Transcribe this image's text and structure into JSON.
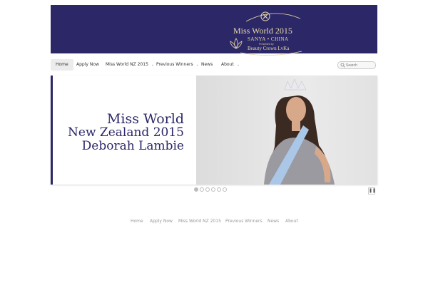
{
  "header": {
    "logo": {
      "title": "Miss World 2015",
      "subtitle": "SANYA • CHINA",
      "powered_by": "Presented by",
      "brand": "Beauty Crown LvKa"
    }
  },
  "nav": {
    "items": [
      {
        "label": "Home",
        "active": true
      },
      {
        "label": "Apply Now"
      },
      {
        "label": "Miss World NZ 2015",
        "has_dropdown": true
      },
      {
        "label": "Previous Winners",
        "has_dropdown": true
      },
      {
        "label": "News"
      },
      {
        "label": "About",
        "has_dropdown": true
      }
    ],
    "search_placeholder": "Search"
  },
  "slider": {
    "line1": "Miss World",
    "line2": "New Zealand 2015",
    "line3": "Deborah Lambie",
    "slide_count": 6,
    "active_slide": 1
  },
  "footer_nav": [
    "Home",
    "Apply Now",
    "Miss World NZ 2015",
    "Previous Winners",
    "News",
    "About"
  ],
  "colors": {
    "brand": "#2c2868",
    "gold": "#e8d9a8"
  }
}
